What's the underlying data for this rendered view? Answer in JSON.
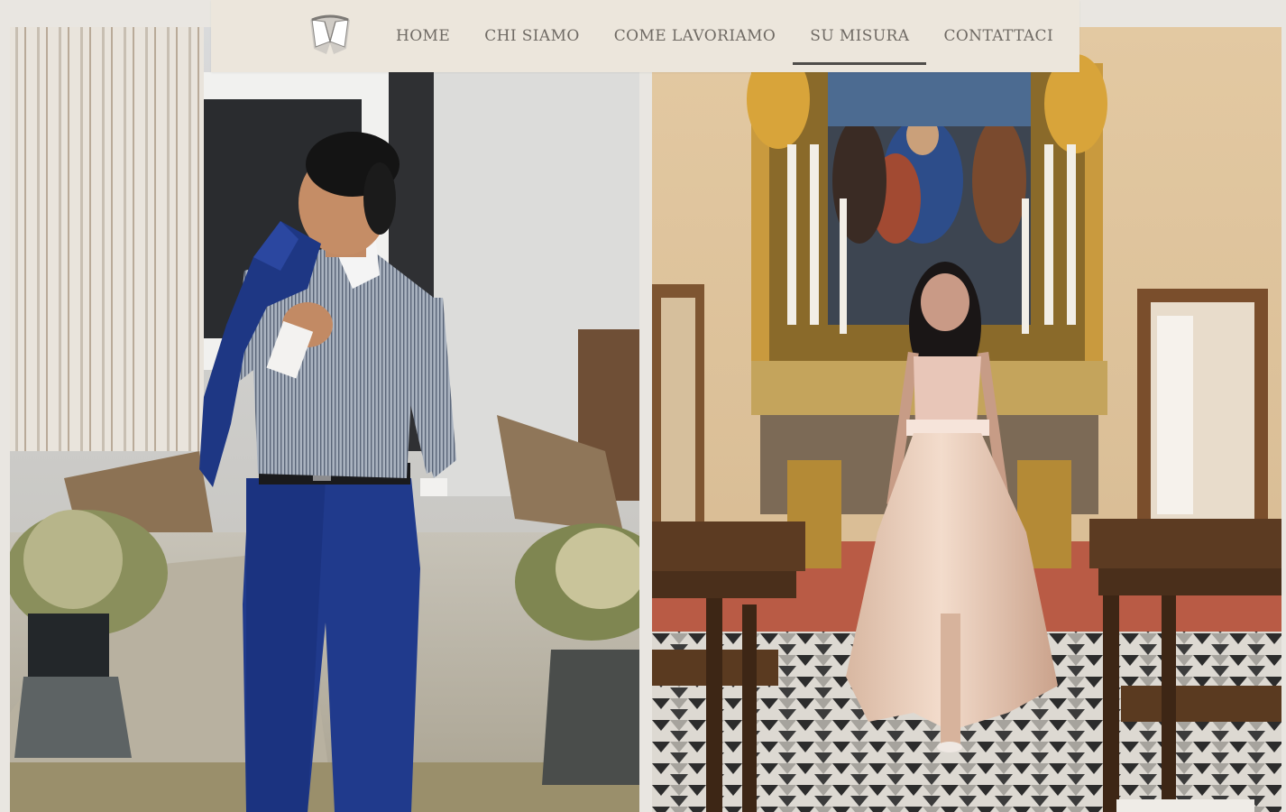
{
  "brand": {
    "logo_icon": "shirt-collar-logo",
    "logo_alt": "logo"
  },
  "nav": {
    "items": [
      {
        "label": "HOME",
        "active": false
      },
      {
        "label": "CHI SIAMO",
        "active": false
      },
      {
        "label": "COME LAVORIAMO",
        "active": false
      },
      {
        "label": "SU MISURA",
        "active": true
      },
      {
        "label": "CONTATTACI",
        "active": false
      }
    ]
  },
  "colors": {
    "page_background": "#e9e6e1",
    "header_background": "#ece6dc",
    "nav_text": "#6f6a64",
    "active_underline": "#4f4d4a"
  },
  "gallery": {
    "images": [
      {
        "subject": "man-in-blue-suit-photo"
      },
      {
        "subject": "woman-in-gown-church-photo"
      }
    ]
  }
}
